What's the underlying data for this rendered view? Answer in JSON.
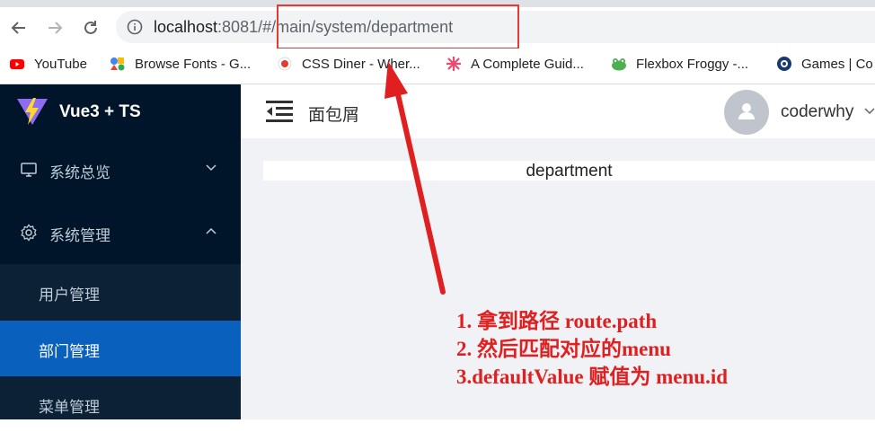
{
  "browser": {
    "url": {
      "host": "localhost",
      "port": ":8081",
      "hash": "/#",
      "path": "/main/system/department"
    },
    "bookmarks": [
      {
        "label": "YouTube",
        "icon": "youtube-icon",
        "color": "#ff0000"
      },
      {
        "label": "Browse Fonts - G...",
        "icon": "google-fonts-icon",
        "color": "#4285f4"
      },
      {
        "label": "CSS Diner - Wher...",
        "icon": "css-diner-icon",
        "color": "#e53935"
      },
      {
        "label": "A Complete Guid...",
        "icon": "css-tricks-icon",
        "color": "#ea4b71"
      },
      {
        "label": "Flexbox Froggy -...",
        "icon": "frog-icon",
        "color": "#4caf50"
      },
      {
        "label": "Games | Co",
        "icon": "games-icon",
        "color": "#1a3a6e"
      }
    ]
  },
  "app": {
    "logo_text": "Vue3 + TS",
    "breadcrumb": "面包屑",
    "username": "coderwhy",
    "page_title": "department"
  },
  "sidebar": {
    "items": [
      {
        "label": "系统总览",
        "icon": "monitor-icon",
        "expanded": false
      },
      {
        "label": "系统管理",
        "icon": "gear-icon",
        "expanded": true
      }
    ],
    "sub_items": [
      {
        "label": "用户管理",
        "active": false
      },
      {
        "label": "部门管理",
        "active": true
      },
      {
        "label": "菜单管理",
        "active": false
      }
    ]
  },
  "annotation": {
    "lines": [
      "1. 拿到路径 route.path",
      "2. 然后匹配对应的menu",
      "3.defaultValue 赋值为 menu.id"
    ]
  },
  "colors": {
    "sidebar_bg": "#001529",
    "submenu_bg": "#0c2135",
    "active_bg": "#0a60bd",
    "annotation_red": "#e02020"
  }
}
